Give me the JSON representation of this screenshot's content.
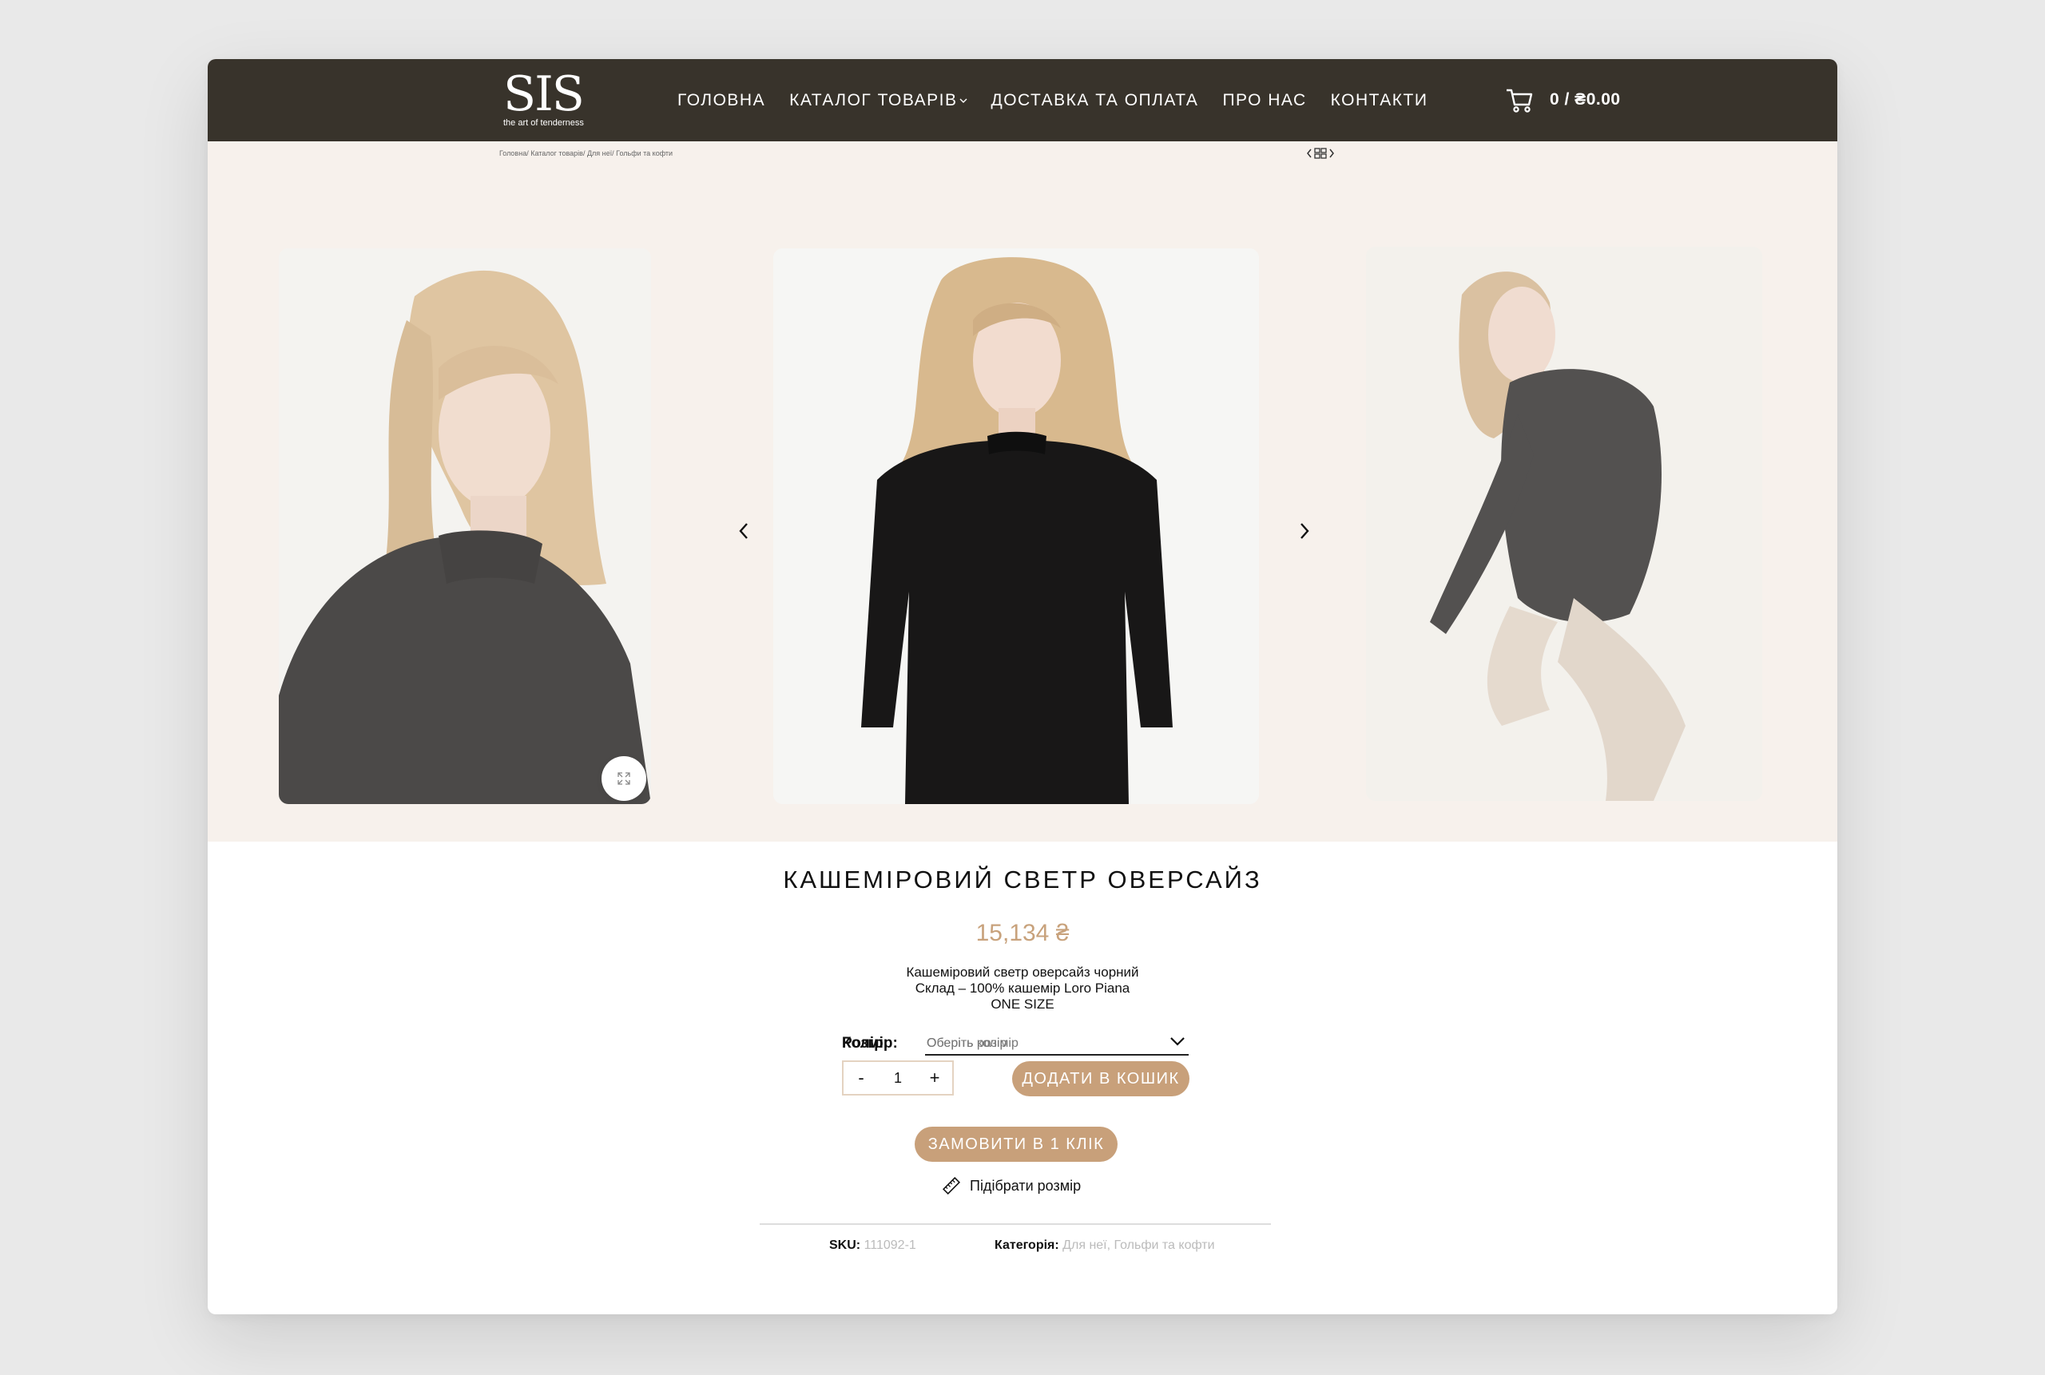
{
  "header": {
    "logo": {
      "mark": "SIS",
      "tagline": "the art of tenderness"
    },
    "nav": [
      {
        "label": "ГОЛОВНА"
      },
      {
        "label": "КАТАЛОГ ТОВАРІВ"
      },
      {
        "label": "ДОСТАВКА ТА ОПЛАТА"
      },
      {
        "label": "ПРО НАС"
      },
      {
        "label": "КОНТАКТИ"
      }
    ],
    "cart": {
      "icon": "cart-icon",
      "total": "0 / ₴0.00"
    }
  },
  "breadcrumb": [
    "Головна",
    "Каталог товарів",
    "Для неї",
    "Гольфи та кофти"
  ],
  "gallery": {
    "icons": [
      "chevron-left-icon",
      "grid-icon",
      "chevron-right-icon",
      "expand-icon"
    ]
  },
  "product": {
    "title": "КАШЕМІРОВИЙ СВЕТР ОВЕРСАЙЗ",
    "price": "15,134 ₴",
    "description": [
      "Кашеміровий светр оверсайз чорний",
      "Склад – 100% кашемір Loro Piana",
      "ONE SIZE"
    ],
    "options": [
      {
        "label": "Колір:",
        "placeholder": "Оберіть колір"
      },
      {
        "label": "Розмір:",
        "placeholder": "Оберіть розімір"
      }
    ],
    "quantity": {
      "minus": "-",
      "value": "1",
      "plus": "+"
    },
    "add_to_cart": "ДОДАТИ В КОШИК",
    "one_click": "ЗАМОВИТИ В 1 КЛІК",
    "size_guide": "Підібрати розмір",
    "sku_label": "SKU:",
    "sku": "111092-1",
    "category_label": "Категорія:",
    "categories": [
      "Для неї",
      "Гольфи та кофти"
    ]
  },
  "colors": {
    "header_bg": "#38332b",
    "gallery_bg": "#f7f1ec",
    "accent": "#c8a07a"
  }
}
